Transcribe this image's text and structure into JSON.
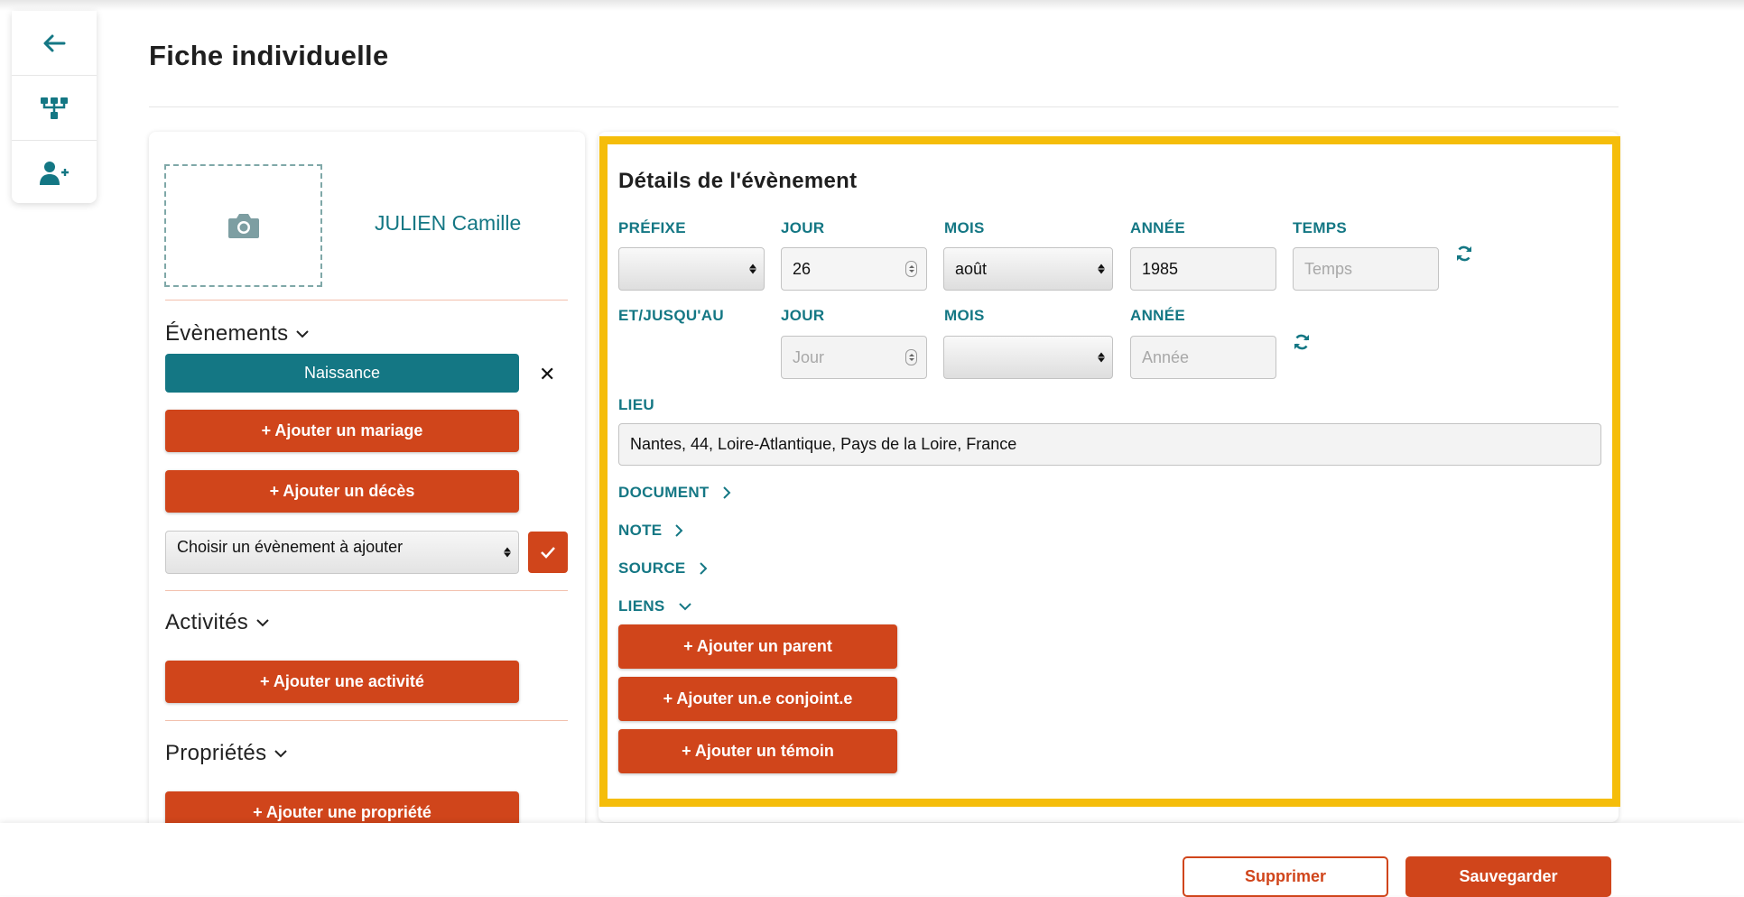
{
  "page": {
    "title": "Fiche individuelle"
  },
  "sidebar": {
    "items": [
      {
        "icon": "arrow-left-icon"
      },
      {
        "icon": "family-tree-icon"
      },
      {
        "icon": "add-person-icon"
      }
    ]
  },
  "person": {
    "name": "JULIEN Camille",
    "photo_icon": "camera-icon"
  },
  "events": {
    "heading": "Évènements",
    "current": "Naissance",
    "add_marriage": "+ Ajouter un mariage",
    "add_death": "+ Ajouter un décès",
    "select_placeholder": "Choisir un évènement à ajouter"
  },
  "activities": {
    "heading": "Activités",
    "add": "+ Ajouter une activité"
  },
  "properties": {
    "heading": "Propriétés",
    "add": "+ Ajouter une propriété"
  },
  "details": {
    "title": "Détails de l'évènement",
    "labels": {
      "prefix": "PRÉFIXE",
      "day": "JOUR",
      "month": "MOIS",
      "year": "ANNÉE",
      "time": "TEMPS",
      "until": "ET/JUSQU'AU",
      "day2": "JOUR",
      "month2": "MOIS",
      "year2": "ANNÉE",
      "place": "LIEU"
    },
    "values": {
      "prefix": "",
      "day": "26",
      "month": "août",
      "year": "1985",
      "time_placeholder": "Temps",
      "day2_placeholder": "Jour",
      "month2": "",
      "year2_placeholder": "Année",
      "place": "Nantes, 44, Loire-Atlantique, Pays de la Loire, France"
    },
    "collapsibles": {
      "document": "DOCUMENT",
      "note": "NOTE",
      "source": "SOURCE",
      "links": "LIENS"
    },
    "links": {
      "add_parent": "+ Ajouter un parent",
      "add_spouse": "+ Ajouter un.e conjoint.e",
      "add_witness": "+ Ajouter un témoin"
    }
  },
  "footer": {
    "delete": "Supprimer",
    "save": "Sauvegarder"
  },
  "colors": {
    "teal": "#147784",
    "orange": "#d0451b",
    "highlight": "#f5bd0a"
  }
}
